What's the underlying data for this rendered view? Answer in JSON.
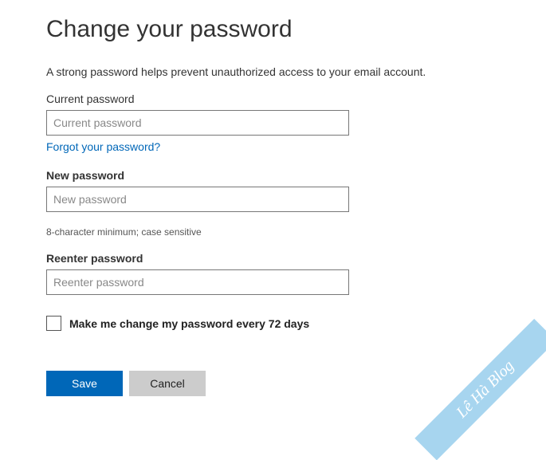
{
  "title": "Change your password",
  "description": "A strong password helps prevent unauthorized access to your email account.",
  "current": {
    "label": "Current password",
    "placeholder": "Current password",
    "forgot_link": "Forgot your password?"
  },
  "new": {
    "label": "New password",
    "placeholder": "New password",
    "hint": "8-character minimum; case sensitive"
  },
  "reenter": {
    "label": "Reenter password",
    "placeholder": "Reenter password"
  },
  "checkbox": {
    "label": "Make me change my password every 72 days",
    "checked": false
  },
  "buttons": {
    "save": "Save",
    "cancel": "Cancel"
  },
  "watermark": "Lê Hà Blog"
}
